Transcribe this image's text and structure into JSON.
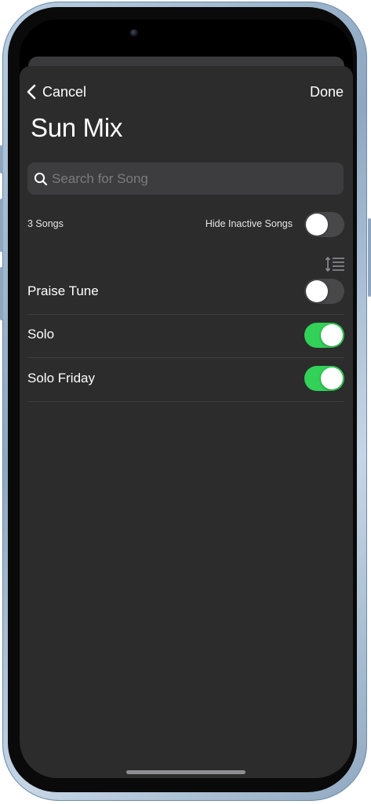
{
  "nav": {
    "cancel_label": "Cancel",
    "done_label": "Done"
  },
  "page": {
    "title": "Sun Mix"
  },
  "search": {
    "placeholder": "Search for Song",
    "value": ""
  },
  "summary": {
    "song_count": "3 Songs",
    "hide_inactive_label": "Hide Inactive Songs",
    "hide_inactive_on": false
  },
  "songs": [
    {
      "name": "Praise Tune",
      "active": false
    },
    {
      "name": "Solo",
      "active": true
    },
    {
      "name": "Solo Friday",
      "active": true
    }
  ],
  "icons": {
    "back": "chevron-left-icon",
    "search": "search-icon",
    "sort": "sort-icon"
  },
  "colors": {
    "sheet_background": "#2c2c2c",
    "toggle_on": "#32d158",
    "toggle_off": "#48484a",
    "search_background": "#3d3d3f"
  }
}
